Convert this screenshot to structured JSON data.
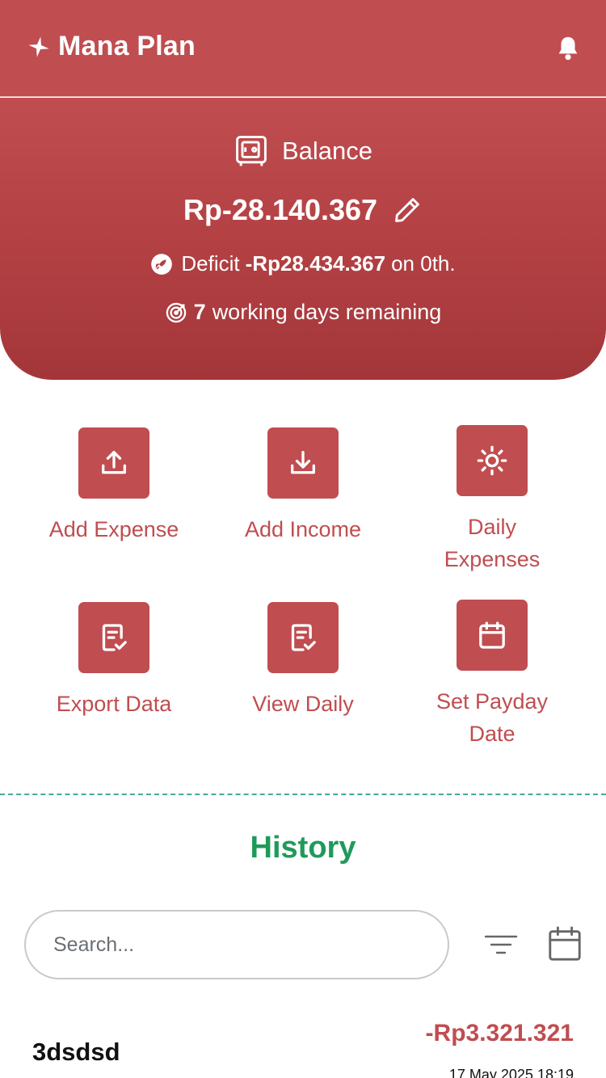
{
  "app": {
    "title": "Mana Plan"
  },
  "balance": {
    "label": "Balance",
    "amount": "Rp-28.140.367",
    "deficit_prefix": "Deficit",
    "deficit_amount": "-Rp28.434.367",
    "deficit_suffix": "on 0th.",
    "days_count": "7",
    "days_text": "working days remaining"
  },
  "actions": [
    {
      "label": "Add Expense",
      "icon": "upload-icon"
    },
    {
      "label": "Add Income",
      "icon": "download-icon"
    },
    {
      "label": "Daily Expenses",
      "icon": "sun-icon"
    },
    {
      "label": "Export Data",
      "icon": "document-check-icon"
    },
    {
      "label": "View Daily",
      "icon": "document-check-icon"
    },
    {
      "label": "Set Payday Date",
      "icon": "calendar-icon"
    }
  ],
  "history": {
    "title": "History",
    "search_placeholder": "Search...",
    "items": [
      {
        "name": "3dsdsd",
        "amount": "-Rp3.321.321",
        "date": "17 May 2025 18:19"
      }
    ]
  },
  "colors": {
    "primary": "#c04d50",
    "history_title": "#1f9a5b",
    "divider": "#48a79b"
  }
}
